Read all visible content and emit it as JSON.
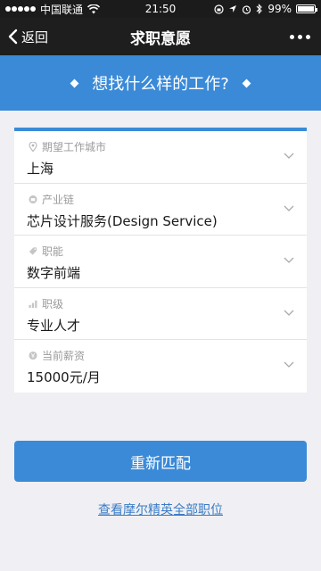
{
  "status_bar": {
    "carrier": "中国联通",
    "time": "21:50",
    "battery": "99%",
    "battery_level": 0.99
  },
  "nav": {
    "back_label": "返回",
    "title": "求职意愿"
  },
  "hero": {
    "title": "想找什么样的工作?"
  },
  "form": {
    "rows": [
      {
        "label": "期望工作城市",
        "value": "上海",
        "icon": "location-pin-icon"
      },
      {
        "label": "产业链",
        "value": "芯片设计服务(Design Service)",
        "icon": "industry-circle-icon"
      },
      {
        "label": "职能",
        "value": "数字前端",
        "icon": "tag-icon"
      },
      {
        "label": "职级",
        "value": "专业人才",
        "icon": "bar-chart-icon"
      },
      {
        "label": "当前薪资",
        "value": "15000元/月",
        "icon": "salary-circle-icon"
      }
    ]
  },
  "actions": {
    "rematch_label": "重新匹配",
    "view_all_label": "查看摩尔精英全部职位"
  },
  "colors": {
    "accent": "#3a8ad8",
    "nav_bg": "#1e1e1e",
    "page_bg": "#efeff4",
    "link": "#3a7cc5"
  }
}
